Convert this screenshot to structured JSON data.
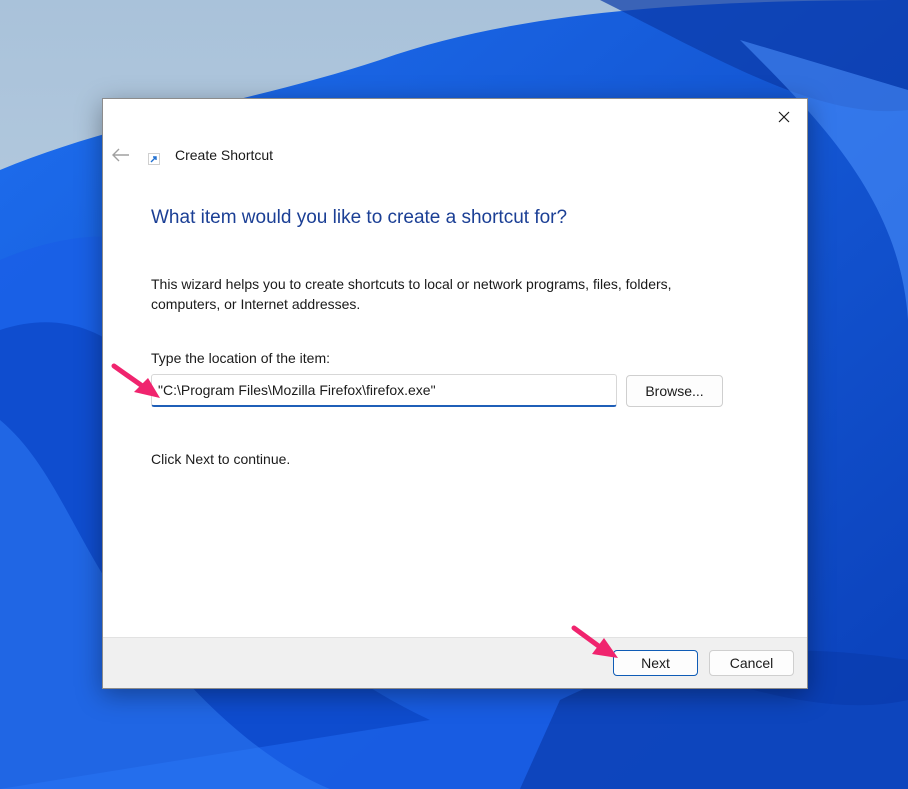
{
  "dialog": {
    "title": "Create Shortcut",
    "heading": "What item would you like to create a shortcut for?",
    "description": "This wizard helps you to create shortcuts to local or network programs, files, folders, computers, or Internet addresses.",
    "location_label": "Type the location of the item:",
    "location_value": "\"C:\\Program Files\\Mozilla Firefox\\firefox.exe\"",
    "browse_label": "Browse...",
    "continue_text": "Click Next to continue.",
    "next_label": "Next",
    "cancel_label": "Cancel"
  },
  "icons": {
    "close": "close-icon",
    "back": "back-arrow-icon",
    "shortcut": "shortcut-icon",
    "annotation": "pointer-arrow-icon"
  },
  "colors": {
    "heading": "#1b3f95",
    "accent": "#1f5fb8",
    "annotation_arrow": "#f0246e",
    "footer": "#f0f0f0"
  }
}
